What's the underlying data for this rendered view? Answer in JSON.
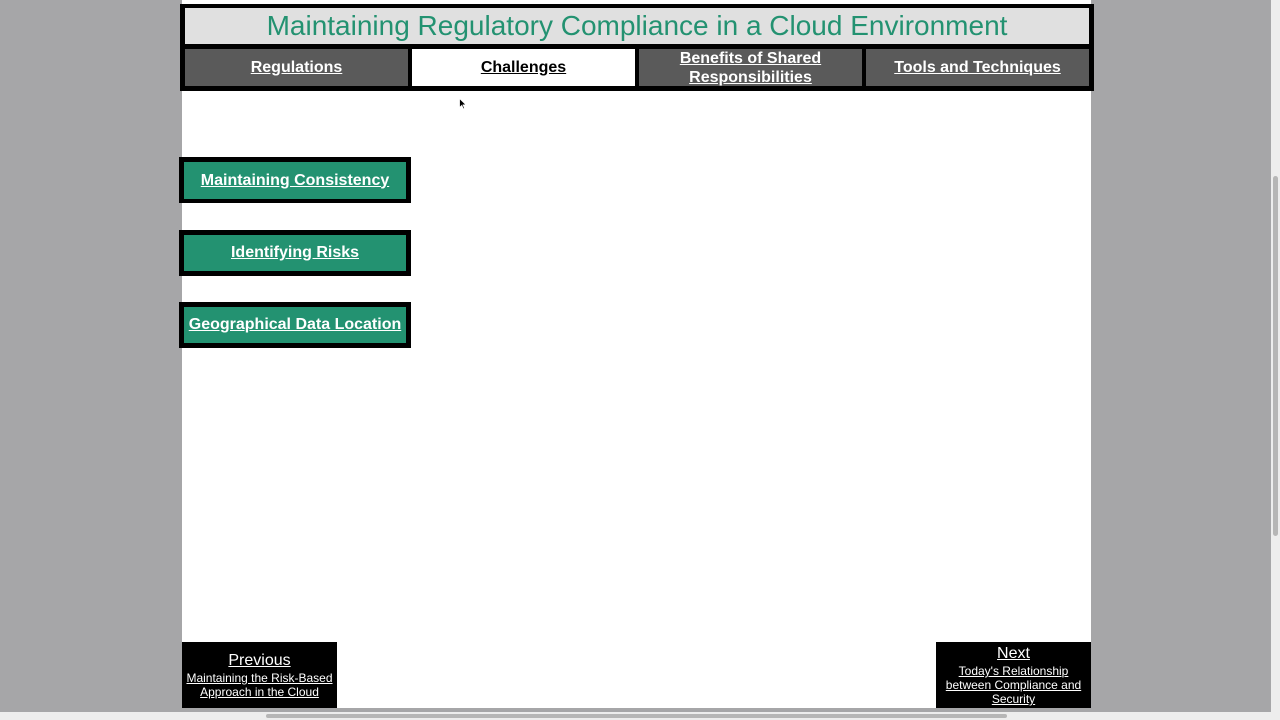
{
  "header": {
    "title": "Maintaining Regulatory Compliance in a Cloud Environment",
    "title_color": "#239271"
  },
  "tabs": [
    {
      "label": "Regulations",
      "active": false
    },
    {
      "label": "Challenges",
      "active": true
    },
    {
      "label": "Benefits of Shared Responsibilities",
      "active": false
    },
    {
      "label": "Tools and Techniques",
      "active": false
    }
  ],
  "side_buttons": [
    {
      "label": "Maintaining Consistency"
    },
    {
      "label": "Identifying Risks"
    },
    {
      "label": "Geographical Data Location"
    }
  ],
  "navigation": {
    "previous": {
      "label": "Previous",
      "page": "Maintaining the Risk-Based Approach in the Cloud"
    },
    "next": {
      "label": "Next",
      "page": "Today's Relationship between Compliance and Security"
    }
  },
  "colors": {
    "accent": "#239271",
    "tab_inactive": "#5a5a5a",
    "frame": "#000000",
    "background": "#a6a6a8"
  },
  "icons": {
    "cursor": "mouse-pointer-icon"
  }
}
